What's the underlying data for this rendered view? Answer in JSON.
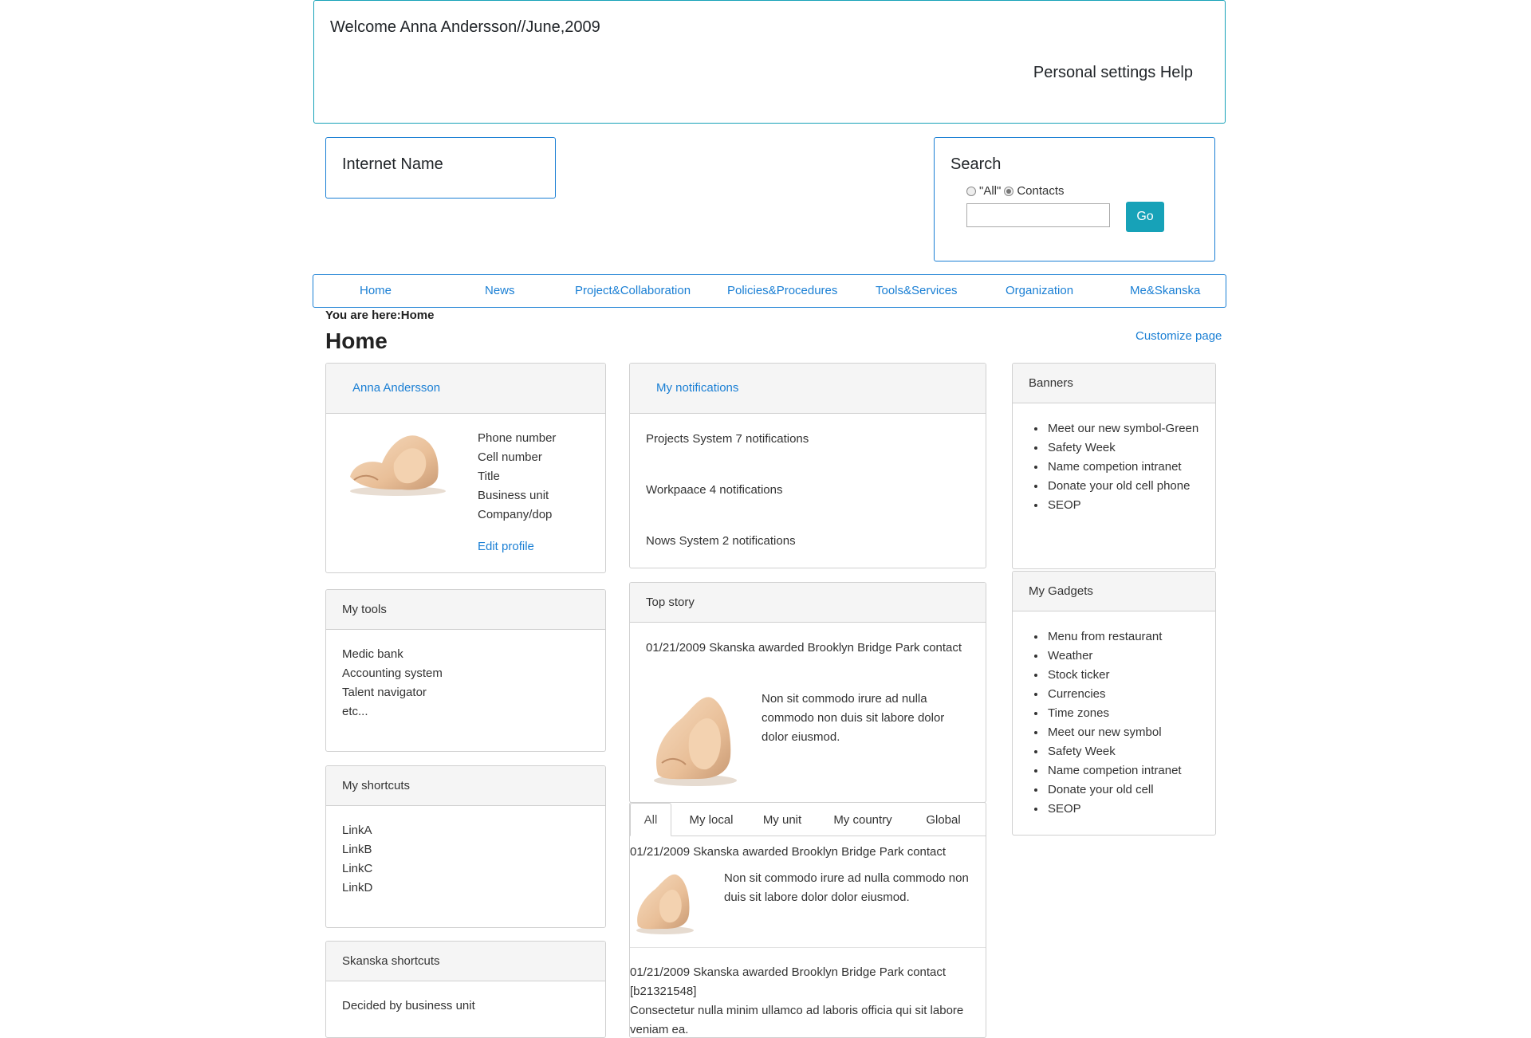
{
  "header": {
    "welcome": "Welcome Anna Andersson//June,2009",
    "personal_links": "Personal settings Help"
  },
  "internet_name": "Internet Name",
  "search": {
    "title": "Search",
    "option_all": "\"All\"",
    "option_contacts": "Contacts",
    "selected": "Contacts",
    "input_value": "",
    "go_label": "Go"
  },
  "nav": {
    "items": [
      "Home",
      "News",
      "Project&Collaboration",
      "Policies&Procedures",
      "Tools&Services",
      "Organization",
      "Me&Skanska"
    ]
  },
  "breadcrumb": "You are here:Home",
  "page_title": "Home",
  "customize": "Customize page",
  "profile": {
    "name": "Anna Andersson",
    "fields": [
      "Phone number",
      "Cell number",
      "Title",
      "Business unit",
      "Company/dop"
    ],
    "edit_label": "Edit profile"
  },
  "my_tools": {
    "title": "My tools",
    "items": [
      "Medic bank",
      "Accounting system",
      "Talent navigator",
      "etc..."
    ]
  },
  "my_shortcuts": {
    "title": "My shortcuts",
    "items": [
      "LinkA",
      "LinkB",
      "LinkC",
      "LinkD"
    ]
  },
  "skanska_shortcuts": {
    "title": "Skanska shortcuts",
    "text": "Decided by business unit"
  },
  "notifications": {
    "title": "My notifications",
    "items": [
      "Projects System 7 notifications",
      "Workpaace 4 notifications",
      "Nows System 2 notifications"
    ]
  },
  "top_story": {
    "title": "Top story",
    "headline": "01/21/2009 Skanska awarded Brooklyn Bridge Park contact",
    "body": "Non sit commodo irure ad nulla commodo non duis sit labore dolor dolor eiusmod."
  },
  "news_tabs": {
    "tabs": [
      "All",
      "My local",
      "My unit",
      "My country",
      "Global"
    ],
    "active": "All",
    "item1": {
      "headline": "01/21/2009 Skanska awarded Brooklyn Bridge Park contact",
      "body": "Non sit commodo irure ad nulla commodo non duis sit labore dolor dolor eiusmod."
    },
    "item2": {
      "headline": "01/21/2009 Skanska awarded Brooklyn Bridge Park contact [b21321548]",
      "body": "Consectetur nulla minim ullamco ad laboris officia qui sit labore veniam ea."
    }
  },
  "banners": {
    "title": "Banners",
    "items": [
      "Meet our new symbol-Green",
      "Safety Week",
      "Name competion intranet",
      "Donate your old cell phone",
      "SEOP"
    ]
  },
  "gadgets": {
    "title": "My Gadgets",
    "items": [
      "Menu from restaurant",
      "Weather",
      "Stock ticker",
      "Currencies",
      "Time zones",
      "Meet our new symbol",
      "Safety Week",
      "Name competion intranet",
      "Donate your old cell",
      "SEOP"
    ]
  },
  "colors": {
    "teal_accent": "#17a2b8",
    "link_blue": "#1a7fd4",
    "card_header_bg": "#f5f5f5"
  }
}
